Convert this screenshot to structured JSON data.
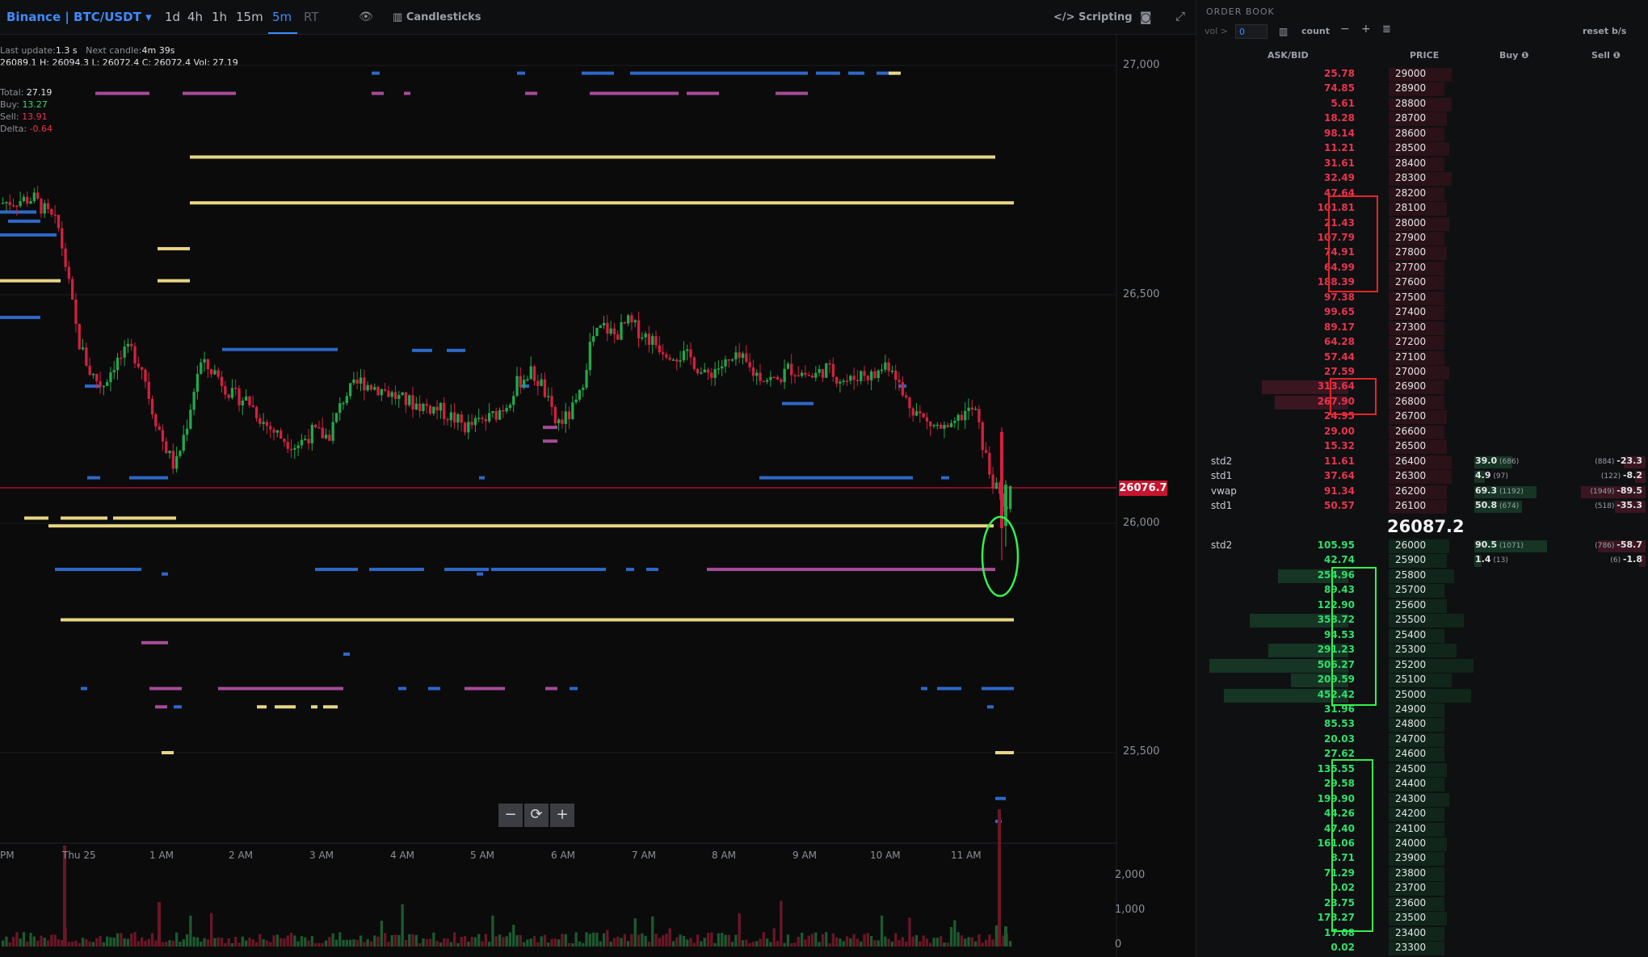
{
  "toolbar": {
    "symbol": "Binance | BTC/USDT",
    "timeframes": [
      "1d",
      "4h",
      "1h",
      "15m",
      "5m",
      "RT"
    ],
    "chart_type": "Candlesticks",
    "scripting": "Scripting"
  },
  "info": {
    "last_update_label": "Last update:",
    "last_update_value": "1.3 s",
    "next_candle_label": "Next candle:",
    "next_candle_value": "4m 39s",
    "ohlc_line": "26089.1 H: 26094.3 L: 26072.4 C: 26072.4 Vol: 27.19",
    "total_label": "Total:",
    "total_value": "27.19",
    "buy_label": "Buy:",
    "buy_value": "13.27",
    "sell_label": "Sell:",
    "sell_value": "13.91",
    "delta_label": "Delta:",
    "delta_value": "-0.64"
  },
  "chart": {
    "price_axis": [
      "27,000",
      "26,500",
      "26,000",
      "25,500"
    ],
    "volume_axis": [
      "2,000",
      "1,000",
      "0"
    ],
    "time_axis": [
      "PM",
      "Thu 25",
      "1 AM",
      "2 AM",
      "3 AM",
      "4 AM",
      "5 AM",
      "6 AM",
      "7 AM",
      "8 AM",
      "9 AM",
      "10 AM",
      "11 AM"
    ],
    "last_price": "26076.7",
    "zoom_out": "−",
    "reset": "⟳",
    "zoom_in": "+"
  },
  "orderbook": {
    "title": "ORDER BOOK",
    "vol_label": "vol >",
    "vol_value": "0",
    "count_label": "count",
    "reset_label": "reset b/s",
    "headers": {
      "askbid": "ASK/BID",
      "price": "PRICE",
      "buy": "Buy ❶",
      "sell": "Sell ❶"
    },
    "mid_price": "26087.2",
    "asks": [
      {
        "qty": "25.78",
        "price": "29000",
        "bg": 0.3
      },
      {
        "qty": "74.85",
        "price": "28900",
        "bg": 0.15
      },
      {
        "qty": "5.61",
        "price": "28800",
        "bg": 0.3
      },
      {
        "qty": "18.28",
        "price": "28700",
        "bg": 0.2
      },
      {
        "qty": "98.14",
        "price": "28600",
        "bg": 0.15
      },
      {
        "qty": "11.21",
        "price": "28500",
        "bg": 0.25
      },
      {
        "qty": "31.61",
        "price": "28400",
        "bg": 0.15
      },
      {
        "qty": "32.49",
        "price": "28300",
        "bg": 0.3
      },
      {
        "qty": "47.64",
        "price": "28200",
        "bg": 0.15
      },
      {
        "qty": "101.81",
        "price": "28100",
        "bg": 0.2
      },
      {
        "qty": "21.43",
        "price": "28000",
        "bg": 0.25
      },
      {
        "qty": "107.79",
        "price": "27900",
        "bg": 0.15
      },
      {
        "qty": "74.91",
        "price": "27800",
        "bg": 0.2
      },
      {
        "qty": "64.99",
        "price": "27700",
        "bg": 0.15
      },
      {
        "qty": "188.39",
        "price": "27600",
        "bg": 0.15
      },
      {
        "qty": "97.38",
        "price": "27500",
        "bg": 0.15
      },
      {
        "qty": "99.65",
        "price": "27400",
        "bg": 0.15
      },
      {
        "qty": "89.17",
        "price": "27300",
        "bg": 0.15
      },
      {
        "qty": "64.28",
        "price": "27200",
        "bg": 0.15
      },
      {
        "qty": "57.44",
        "price": "27100",
        "bg": 0.15
      },
      {
        "qty": "27.59",
        "price": "27000",
        "bg": 0.25
      },
      {
        "qty": "313.64",
        "price": "26900",
        "bg": 0.15
      },
      {
        "qty": "267.90",
        "price": "26800",
        "bg": 0.15
      },
      {
        "qty": "24.95",
        "price": "26700",
        "bg": 0.2
      },
      {
        "qty": "29.00",
        "price": "26600",
        "bg": 0.15
      },
      {
        "qty": "15.32",
        "price": "26500",
        "bg": 0.2
      },
      {
        "qty": "11.61",
        "price": "26400",
        "bg": 0.3,
        "label": "std2",
        "buy": "39.0",
        "buy_n": "(686)",
        "sell": "-23.3",
        "sell_n": "(884)"
      },
      {
        "qty": "37.64",
        "price": "26300",
        "bg": 0.3,
        "label": "std1",
        "buy": "4.9",
        "buy_n": "(97)",
        "sell": "-8.2",
        "sell_n": "(122)"
      },
      {
        "qty": "91.34",
        "price": "26200",
        "bg": 0.2,
        "label": "vwap",
        "buy": "69.3",
        "buy_n": "(1192)",
        "sell": "-89.5",
        "sell_n": "(1949)"
      },
      {
        "qty": "50.57",
        "price": "26100",
        "bg": 0.2,
        "label": "std1",
        "buy": "50.8",
        "buy_n": "(674)",
        "sell": "-35.3",
        "sell_n": "(518)"
      }
    ],
    "bids": [
      {
        "qty": "105.95",
        "price": "26000",
        "bg": 0.25,
        "label": "std2",
        "buy": "90.5",
        "buy_n": "(1071)",
        "sell": "-58.7",
        "sell_n": "(786)"
      },
      {
        "qty": "42.74",
        "price": "25900",
        "bg": 0.2,
        "buy": "1.4",
        "buy_n": "(13)",
        "sell": "-1.8",
        "sell_n": "(6)"
      },
      {
        "qty": "254.96",
        "price": "25800",
        "bg": 0.35
      },
      {
        "qty": "89.43",
        "price": "25700",
        "bg": 0.15
      },
      {
        "qty": "122.90",
        "price": "25600",
        "bg": 0.2
      },
      {
        "qty": "358.72",
        "price": "25500",
        "bg": 0.55
      },
      {
        "qty": "94.53",
        "price": "25400",
        "bg": 0.15
      },
      {
        "qty": "291.23",
        "price": "25300",
        "bg": 0.4
      },
      {
        "qty": "506.27",
        "price": "25200",
        "bg": 0.75
      },
      {
        "qty": "209.59",
        "price": "25100",
        "bg": 0.3
      },
      {
        "qty": "452.42",
        "price": "25000",
        "bg": 0.7
      },
      {
        "qty": "31.96",
        "price": "24900",
        "bg": 0.15
      },
      {
        "qty": "85.53",
        "price": "24800",
        "bg": 0.15
      },
      {
        "qty": "20.03",
        "price": "24700",
        "bg": 0.15
      },
      {
        "qty": "27.62",
        "price": "24600",
        "bg": 0.15
      },
      {
        "qty": "135.55",
        "price": "24500",
        "bg": 0.2
      },
      {
        "qty": "29.58",
        "price": "24400",
        "bg": 0.15
      },
      {
        "qty": "199.90",
        "price": "24300",
        "bg": 0.25
      },
      {
        "qty": "44.26",
        "price": "24200",
        "bg": 0.15
      },
      {
        "qty": "47.40",
        "price": "24100",
        "bg": 0.15
      },
      {
        "qty": "161.06",
        "price": "24000",
        "bg": 0.2
      },
      {
        "qty": "8.71",
        "price": "23900",
        "bg": 0.15
      },
      {
        "qty": "71.29",
        "price": "23800",
        "bg": 0.15
      },
      {
        "qty": "0.02",
        "price": "23700",
        "bg": 0.15
      },
      {
        "qty": "23.75",
        "price": "23600",
        "bg": 0.15
      },
      {
        "qty": "173.27",
        "price": "23500",
        "bg": 0.2
      },
      {
        "qty": "17.08",
        "price": "23400",
        "bg": 0.15
      },
      {
        "qty": "0.02",
        "price": "23300",
        "bg": 0.15
      }
    ]
  },
  "colors": {
    "up": "#22a84a",
    "down": "#d3203f",
    "accent": "#3d8bff",
    "heat_yellow": "#f3e28a",
    "heat_blue": "#2f6ed3",
    "heat_pink": "#b04fa0",
    "ask_text": "#e8334e",
    "bid_text": "#2ee06a"
  }
}
